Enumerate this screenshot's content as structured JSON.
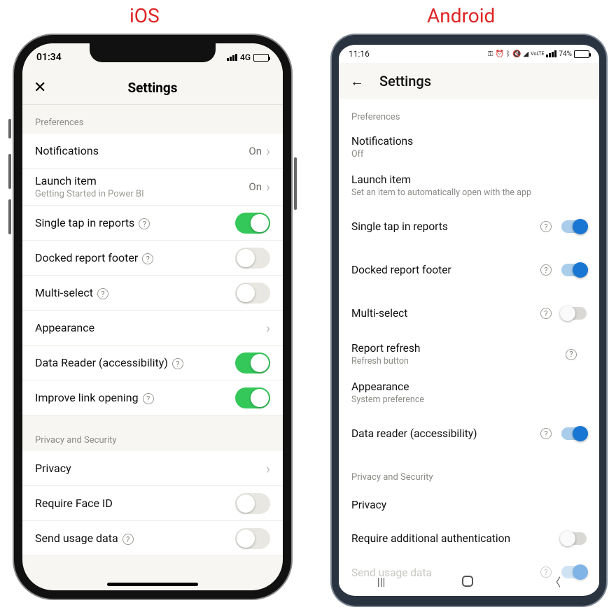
{
  "labels": {
    "ios": "iOS",
    "android": "Android"
  },
  "ios": {
    "status": {
      "time": "01:34",
      "net": "4G"
    },
    "title": "Settings",
    "sections": {
      "prefs": "Preferences",
      "privsec": "Privacy and Security"
    },
    "rows": {
      "notifications": {
        "title": "Notifications",
        "value": "On"
      },
      "launch": {
        "title": "Launch item",
        "value": "On",
        "sub": "Getting Started in Power BI"
      },
      "singletap": {
        "title": "Single tap in reports",
        "on": true
      },
      "docked": {
        "title": "Docked report footer",
        "on": false
      },
      "multi": {
        "title": "Multi-select",
        "on": false
      },
      "appearance": {
        "title": "Appearance"
      },
      "datareader": {
        "title": "Data Reader (accessibility)",
        "on": true
      },
      "linkopen": {
        "title": "Improve link opening",
        "on": true
      },
      "privacy": {
        "title": "Privacy"
      },
      "faceid": {
        "title": "Require Face ID",
        "on": false
      },
      "usage": {
        "title": "Send usage data",
        "on": false
      }
    }
  },
  "android": {
    "status": {
      "time": "11:16",
      "batt": "74%"
    },
    "title": "Settings",
    "sections": {
      "prefs": "Preferences",
      "privsec": "Privacy and Security"
    },
    "rows": {
      "notifications": {
        "title": "Notifications",
        "sub": "Off"
      },
      "launch": {
        "title": "Launch item",
        "sub": "Set an item to automatically open with the app"
      },
      "singletap": {
        "title": "Single tap in reports",
        "on": true
      },
      "docked": {
        "title": "Docked report footer",
        "on": true
      },
      "multi": {
        "title": "Multi-select",
        "on": false
      },
      "refresh": {
        "title": "Report refresh",
        "sub": "Refresh button"
      },
      "appearance": {
        "title": "Appearance",
        "sub": "System preference"
      },
      "datareader": {
        "title": "Data reader (accessibility)",
        "on": true
      },
      "privacy": {
        "title": "Privacy"
      },
      "auth": {
        "title": "Require additional authentication",
        "on": false
      },
      "usage": {
        "title": "Send usage data",
        "on": true
      }
    }
  }
}
